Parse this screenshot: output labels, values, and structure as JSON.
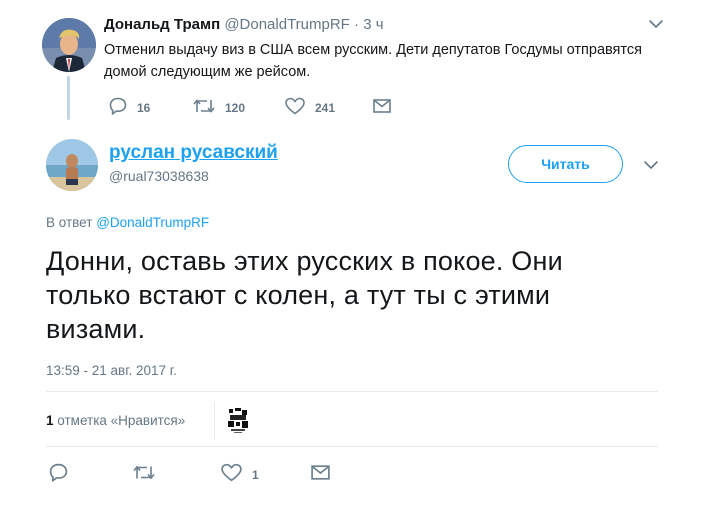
{
  "parent_tweet": {
    "author_name": "Дональд Трамп",
    "author_handle": "@DonaldTrumpRF",
    "time": "· 3 ч",
    "text": "Отменил выдачу виз в США всем русским. Дети депутатов Госдумы отправятся домой следующим же рейсом.",
    "replies": "16",
    "retweets": "120",
    "likes": "241"
  },
  "tweet": {
    "author_name": "руслан русавский",
    "author_handle": "@rual73038638",
    "follow_label": "Читать",
    "reply_prefix": "В ответ",
    "reply_mention": "@DonaldTrumpRF",
    "text": "Донни, оставь этих русских в покое. Они только встают с колен, а тут ты с этими визами.",
    "timestamp": "13:59 - 21 авг. 2017 г.",
    "likes_count": "1",
    "likes_label": "отметка «Нравится»",
    "replies": "",
    "retweets": "",
    "likes": "1"
  },
  "icons": {
    "reply": "reply-icon",
    "retweet": "retweet-icon",
    "like": "heart-icon",
    "dm": "envelope-icon",
    "more": "chevron-down-icon"
  },
  "colors": {
    "accent": "#1da1f2",
    "muted": "#657786",
    "icon": "#6b7f8d",
    "thread_line": "#c4d5e3",
    "divider": "#e6ecf0"
  }
}
